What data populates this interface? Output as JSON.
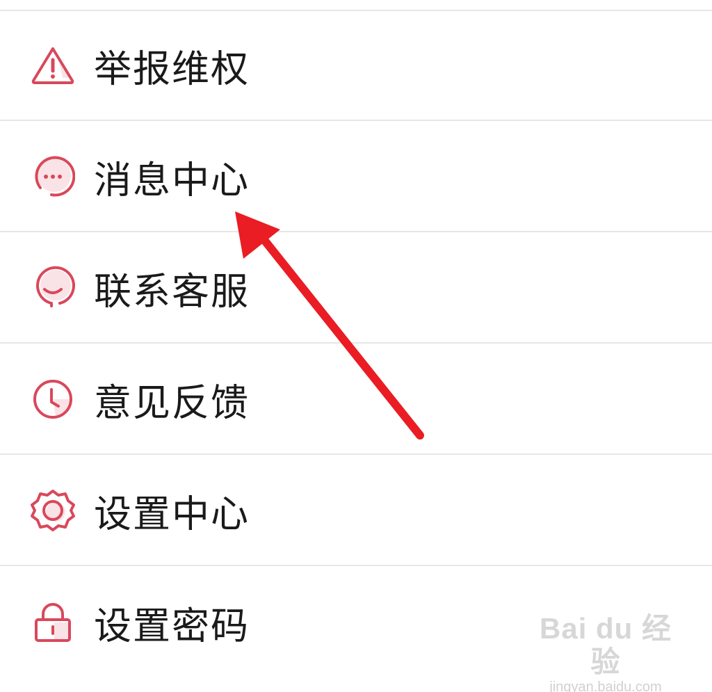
{
  "menu": {
    "items": [
      {
        "label": "举报维权",
        "icon": "warning-triangle-icon"
      },
      {
        "label": "消息中心",
        "icon": "message-bubble-icon"
      },
      {
        "label": "联系客服",
        "icon": "customer-service-icon"
      },
      {
        "label": "意见反馈",
        "icon": "clock-icon"
      },
      {
        "label": "设置中心",
        "icon": "gear-icon"
      },
      {
        "label": "设置密码",
        "icon": "lock-icon"
      }
    ]
  },
  "colors": {
    "icon_red": "#d9485b",
    "icon_fill": "#f9e3e6",
    "arrow": "#ea1c24",
    "divider": "#e6e6e6",
    "text": "#1a1a1a"
  },
  "watermark": {
    "brand": "Bai du 经验",
    "url": "jingyan.baidu.com"
  }
}
